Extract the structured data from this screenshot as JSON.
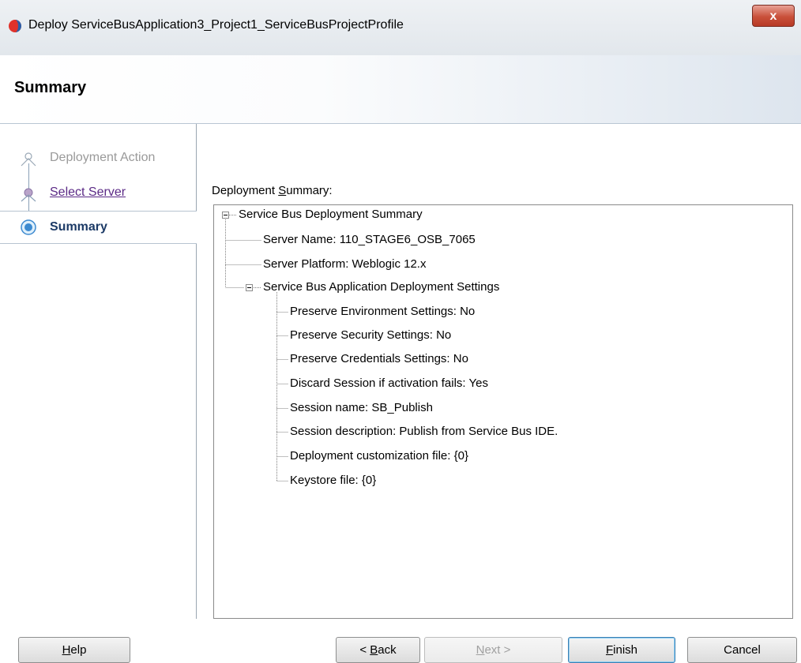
{
  "window": {
    "title": "Deploy ServiceBusApplication3_Project1_ServiceBusProjectProfile",
    "close_label": "x",
    "icon": "oracle-app-icon"
  },
  "header": {
    "title": "Summary"
  },
  "nav": {
    "steps": [
      {
        "label": "Deployment Action",
        "state": "disabled",
        "icon": "step-icon"
      },
      {
        "label": "Select Server",
        "state": "visited",
        "icon": "step-icon"
      },
      {
        "label": "Summary",
        "state": "current",
        "icon": "current-step-icon"
      }
    ]
  },
  "content": {
    "section_label_pre": "Deployment ",
    "section_label_mn": "S",
    "section_label_post": "ummary:",
    "tree": {
      "root": "Service Bus Deployment Summary",
      "server_name": "Server Name: 110_STAGE6_OSB_7065",
      "server_platform": "Server Platform: Weblogic 12.x",
      "app_settings": "Service Bus Application Deployment Settings",
      "settings": [
        "Preserve Environment Settings: No",
        "Preserve Security Settings: No",
        "Preserve Credentials Settings: No",
        "Discard Session if activation fails: Yes",
        "Session name: SB_Publish",
        "Session description: Publish from Service Bus IDE.",
        "Deployment customization file: {0}",
        "Keystore file: {0}"
      ]
    }
  },
  "footer": {
    "help": {
      "mn": "H",
      "rest": "elp"
    },
    "back": {
      "pre": "< ",
      "mn": "B",
      "rest": "ack"
    },
    "next": {
      "mn": "N",
      "rest": "ext >"
    },
    "finish": {
      "mn": "F",
      "rest": "inish"
    },
    "cancel": "Cancel"
  }
}
